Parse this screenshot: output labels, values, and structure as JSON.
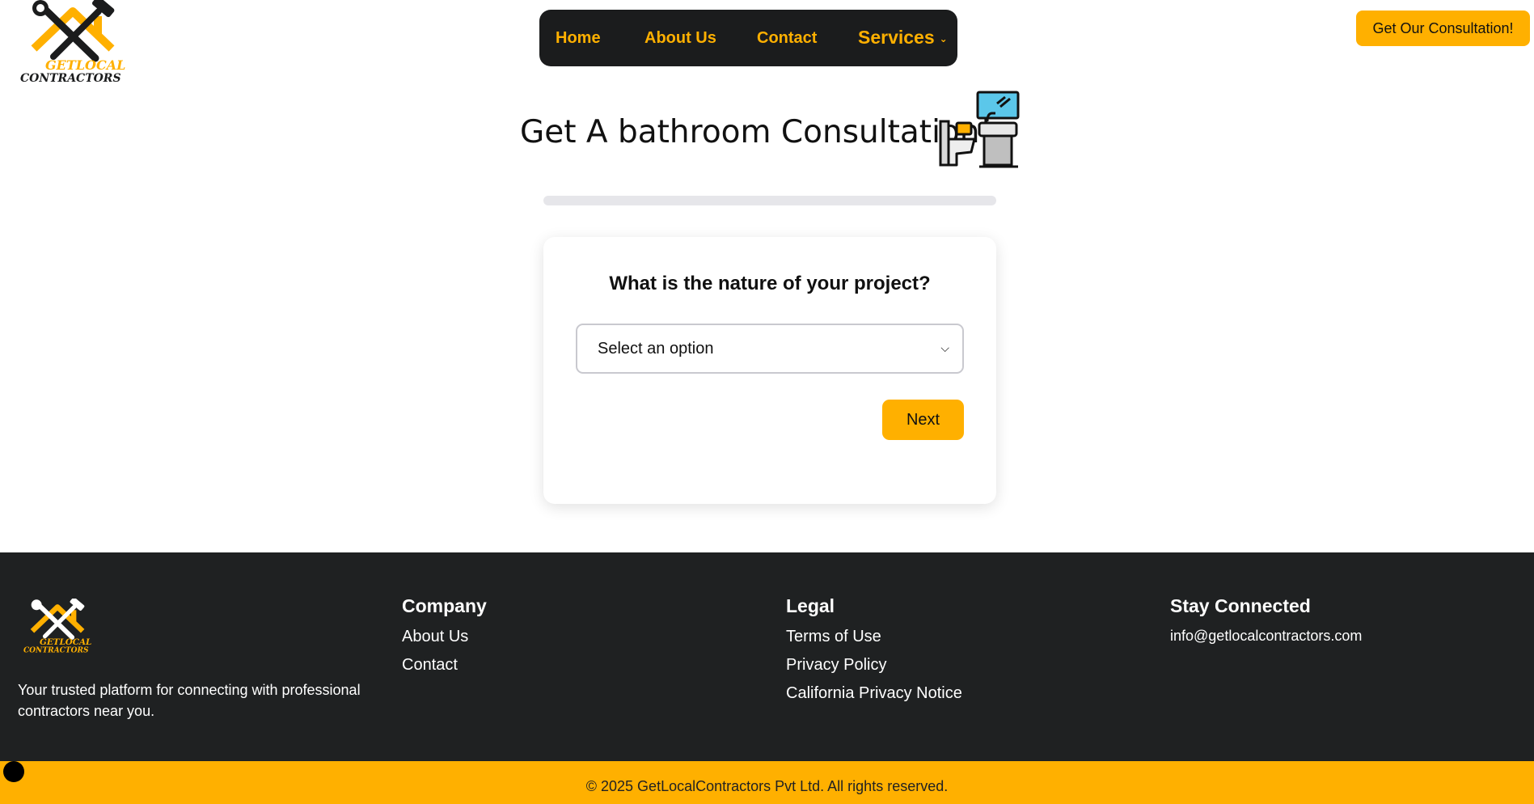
{
  "header": {
    "logo_text_line1": "GETLOCAL",
    "logo_text_line2": "CONTRACTORS",
    "nav": {
      "home": "Home",
      "about": "About Us",
      "contact": "Contact",
      "services": "Services"
    },
    "cta": "Get Our Consultation!"
  },
  "main": {
    "title": "Get A bathroom Consultation!",
    "icon": "bathroom-icon",
    "progress_fraction": 0,
    "question": "What is the nature of your project?",
    "select_value": "Select an option",
    "next_label": "Next"
  },
  "footer": {
    "tagline": "Your trusted platform for connecting with professional contractors near you.",
    "company": {
      "heading": "Company",
      "links": [
        "About Us",
        "Contact"
      ]
    },
    "legal": {
      "heading": "Legal",
      "links": [
        "Terms of Use",
        "Privacy Policy",
        "California Privacy Notice"
      ]
    },
    "stay": {
      "heading": "Stay Connected",
      "email": "info@getlocalcontractors.com"
    },
    "copyright": "© 2025 GetLocalContractors Pvt Ltd. All rights reserved."
  },
  "colors": {
    "accent": "#ffb000",
    "nav_bg": "#1b1c1d",
    "footer_bg": "#1f2122"
  }
}
